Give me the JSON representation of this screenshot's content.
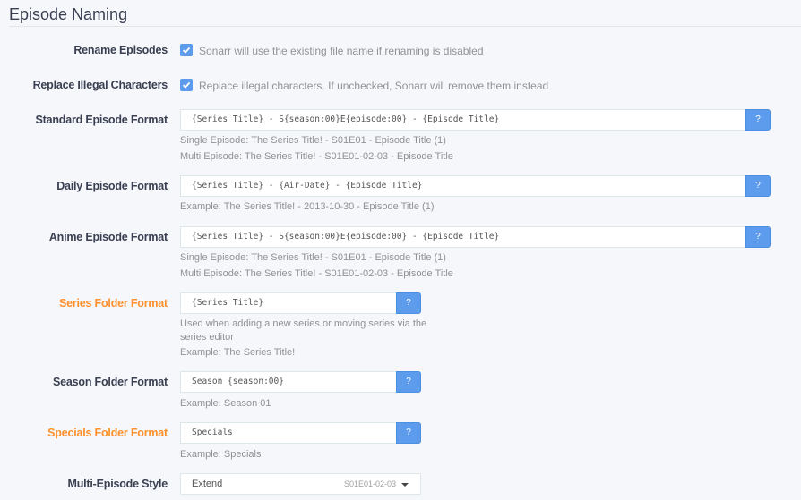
{
  "section": {
    "title": "Episode Naming"
  },
  "rename": {
    "label": "Rename Episodes",
    "checked": true,
    "help": "Sonarr will use the existing file name if renaming is disabled"
  },
  "illegal": {
    "label": "Replace Illegal Characters",
    "checked": true,
    "help": "Replace illegal characters. If unchecked, Sonarr will remove them instead"
  },
  "standard": {
    "label": "Standard Episode Format",
    "value": "{Series Title} - S{season:00}E{episode:00} - {Episode Title}",
    "help_button": "?",
    "example1": "Single Episode: The Series Title! - S01E01 - Episode Title (1)",
    "example2": "Multi Episode: The Series Title! - S01E01-02-03 - Episode Title"
  },
  "daily": {
    "label": "Daily Episode Format",
    "value": "{Series Title} - {Air-Date} - {Episode Title}",
    "help_button": "?",
    "example1": "Example: The Series Title! - 2013-10-30 - Episode Title (1)"
  },
  "anime": {
    "label": "Anime Episode Format",
    "value": "{Series Title} - S{season:00}E{episode:00} - {Episode Title}",
    "help_button": "?",
    "example1": "Single Episode: The Series Title! - S01E01 - Episode Title (1)",
    "example2": "Multi Episode: The Series Title! - S01E01-02-03 - Episode Title"
  },
  "series_folder": {
    "label": "Series Folder Format",
    "value": "{Series Title}",
    "help_button": "?",
    "help_line1": "Used when adding a new series or moving series via the",
    "help_line2": "series editor",
    "example1": "Example: The Series Title!"
  },
  "season_folder": {
    "label": "Season Folder Format",
    "value": "Season {season:00}",
    "help_button": "?",
    "example1": "Example: Season 01"
  },
  "specials_folder": {
    "label": "Specials Folder Format",
    "value": "Specials",
    "help_button": "?",
    "example1": "Example: Specials"
  },
  "multi_episode": {
    "label": "Multi-Episode Style",
    "selected": "Extend",
    "selected_hint": "S01E01-02-03"
  },
  "colors": {
    "accent": "#5d9cec",
    "advanced_label": "#ff902b"
  }
}
